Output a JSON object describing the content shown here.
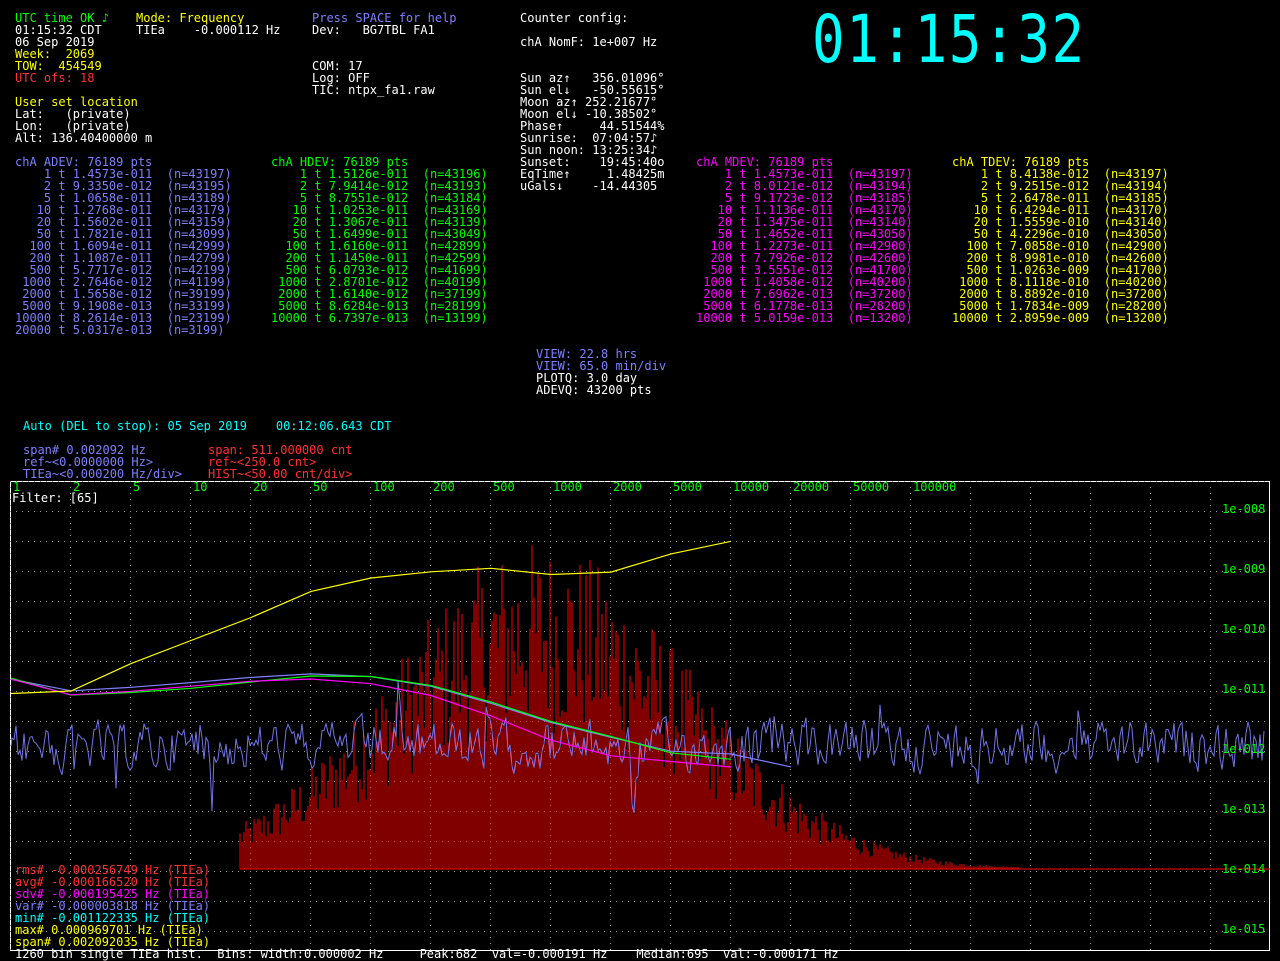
{
  "status": {
    "utc_status": "UTC time OK ♪",
    "time_line": "01:15:32 CDT",
    "date": "06 Sep 2019",
    "week": "Week:  2069",
    "tow": "TOW:  454549",
    "utc_ofs": "UTC ofs: 18",
    "mode": "Mode: Frequency",
    "tiea": "TIEa    -0.000112 Hz",
    "help": "Press SPACE for help",
    "dev": "Dev:   BG7TBL FA1",
    "com": "COM: 17",
    "log": "Log: OFF",
    "tic": "TIC: ntpx_fa1.raw",
    "counter_title": "Counter config:",
    "nomf": "chA NomF: 1e+007 Hz"
  },
  "location": {
    "title": "User set location",
    "lat": "Lat:   (private)",
    "lon": "Lon:   (private)",
    "alt": "Alt: 136.40400000 m"
  },
  "astro": [
    "Sun az↑   356.01096°",
    "Sun el↓   -50.55615°",
    "Moon az↑ 252.21677°",
    "Moon el↓ -10.38502°",
    "Phase↑     44.51544%",
    "Sunrise:  07:04:57♪",
    "Sun noon: 13:25:34♪",
    "Sunset:    19:45:40o",
    "EqTime↑     1.48425m",
    "uGals↓    -14.44305"
  ],
  "clock": "01:15:32",
  "adev": {
    "title": "chA ADEV: 76189 pts",
    "rows": [
      "    1 t 1.4573e-011  (n=43197)",
      "    2 t 9.3350e-012  (n=43195)",
      "    5 t 1.0658e-011  (n=43189)",
      "   10 t 1.2768e-011  (n=43179)",
      "   20 t 1.5602e-011  (n=43159)",
      "   50 t 1.7821e-011  (n=43099)",
      "  100 t 1.6094e-011  (n=42999)",
      "  200 t 1.1087e-011  (n=42799)",
      "  500 t 5.7717e-012  (n=42199)",
      " 1000 t 2.7646e-012  (n=41199)",
      " 2000 t 1.5658e-012  (n=39199)",
      " 5000 t 9.1908e-013  (n=33199)",
      "10000 t 8.2614e-013  (n=23199)",
      "20000 t 5.0317e-013  (n=3199)"
    ]
  },
  "hdev": {
    "title": "chA HDEV: 76189 pts",
    "rows": [
      "    1 t 1.5126e-011  (n=43196)",
      "    2 t 7.9414e-012  (n=43193)",
      "    5 t 8.7551e-012  (n=43184)",
      "   10 t 1.0253e-011  (n=43169)",
      "   20 t 1.3067e-011  (n=43139)",
      "   50 t 1.6499e-011  (n=43049)",
      "  100 t 1.6160e-011  (n=42899)",
      "  200 t 1.1450e-011  (n=42599)",
      "  500 t 6.0793e-012  (n=41699)",
      " 1000 t 2.8701e-012  (n=40199)",
      " 2000 t 1.6140e-012  (n=37199)",
      " 5000 t 8.6284e-013  (n=28199)",
      "10000 t 6.7397e-013  (n=13199)"
    ]
  },
  "mdev": {
    "title": "chA MDEV: 76189 pts",
    "rows": [
      "    1 t 1.4573e-011  (n=43197)",
      "    2 t 8.0121e-012  (n=43194)",
      "    5 t 9.1723e-012  (n=43185)",
      "   10 t 1.1136e-011  (n=43170)",
      "   20 t 1.3475e-011  (n=43140)",
      "   50 t 1.4652e-011  (n=43050)",
      "  100 t 1.2273e-011  (n=42900)",
      "  200 t 7.7926e-012  (n=42600)",
      "  500 t 3.5551e-012  (n=41700)",
      " 1000 t 1.4058e-012  (n=40200)",
      " 2000 t 7.6962e-013  (n=37200)",
      " 5000 t 6.1778e-013  (n=28200)",
      "10000 t 5.0159e-013  (n=13200)"
    ]
  },
  "tdev": {
    "title": "chA TDEV: 76189 pts",
    "rows": [
      "    1 t 8.4138e-012  (n=43197)",
      "    2 t 9.2515e-012  (n=43194)",
      "    5 t 2.6478e-011  (n=43185)",
      "   10 t 6.4294e-011  (n=43170)",
      "   20 t 1.5559e-010  (n=43140)",
      "   50 t 4.2296e-010  (n=43050)",
      "  100 t 7.0858e-010  (n=42900)",
      "  200 t 8.9981e-010  (n=42600)",
      "  500 t 1.0263e-009  (n=41700)",
      " 1000 t 8.1118e-010  (n=40200)",
      " 2000 t 8.8892e-010  (n=37200)",
      " 5000 t 1.7834e-009  (n=28200)",
      "10000 t 2.8959e-009  (n=13200)"
    ]
  },
  "view": {
    "view_hrs": "VIEW: 22.8 hrs",
    "view_min": "VIEW: 65.0 min/div",
    "plotq": "PLOTQ: 3.0 day",
    "adevq": "ADEVQ: 43200 pts"
  },
  "auto_line": "Auto (DEL to stop): 05 Sep 2019    00:12:06.643 CDT",
  "scale": {
    "span_hz": "span# 0.002092 Hz",
    "ref_hz": "ref~<0.0000000 Hz>",
    "tiea_div": "TIEa~<0.000200 Hz/div>",
    "span_cnt": "span: 511.000000 cnt",
    "ref_cnt": "ref~<250.0 cnt>",
    "hist_div": "HIST~<50.00 cnt/div>"
  },
  "filter": "Filter: [65]",
  "tau_labels": [
    "1",
    "2",
    "5",
    "10",
    "20",
    "50",
    "100",
    "200",
    "500",
    "1000",
    "2000",
    "5000",
    "10000",
    "20000",
    "50000",
    "100000"
  ],
  "decade_labels": [
    "1e-008",
    "1e-009",
    "1e-010",
    "1e-011",
    "1e-012",
    "1e-013",
    "1e-014",
    "1e-015"
  ],
  "stats": {
    "rms": "rms# -0.000256749 Hz (TIEa)",
    "avg": "avg# -0.000166520 Hz (TIEa)",
    "sdv": "sdv# -0.000195425 Hz (TIEa)",
    "var": "var# -0.000003818 Hz (TIEa)",
    "min": "min# -0.001122335 Hz (TIEa)",
    "max": "max# 0.000969701 Hz (TIEa)",
    "span": "span# 0.002092035 Hz (TIEa)"
  },
  "bottom_line": "1260 bin single TIEa hist.  Bins: width:0.000002 Hz     Peak:682  val=-0.000191 Hz    Median:695  val:-0.000171 Hz",
  "colors": {
    "adev": "#7f7fff",
    "hdev": "#00ff00",
    "mdev": "#ff00ff",
    "tdev": "#ffff00",
    "hist": "#ff0000",
    "tiea": "#7f7fff",
    "grid": "#ffffff"
  },
  "chart_data": {
    "type": "line",
    "xscale": "log",
    "yscale": "log",
    "x_tau": [
      1,
      2,
      5,
      10,
      20,
      50,
      100,
      200,
      500,
      1000,
      2000,
      5000,
      10000,
      20000
    ],
    "series": [
      {
        "name": "chA ADEV",
        "values": [
          1.4573e-11,
          9.335e-12,
          1.0658e-11,
          1.2768e-11,
          1.5602e-11,
          1.7821e-11,
          1.6094e-11,
          1.1087e-11,
          5.7717e-12,
          2.7646e-12,
          1.5658e-12,
          9.1908e-13,
          8.2614e-13,
          5.0317e-13
        ]
      },
      {
        "name": "chA HDEV",
        "values": [
          1.5126e-11,
          7.9414e-12,
          8.7551e-12,
          1.0253e-11,
          1.3067e-11,
          1.6499e-11,
          1.616e-11,
          1.145e-11,
          6.0793e-12,
          2.8701e-12,
          1.614e-12,
          8.6284e-13,
          6.7397e-13
        ]
      },
      {
        "name": "chA MDEV",
        "values": [
          1.4573e-11,
          8.0121e-12,
          9.1723e-12,
          1.1136e-11,
          1.3475e-11,
          1.4652e-11,
          1.2273e-11,
          7.7926e-12,
          3.5551e-12,
          1.4058e-12,
          7.6962e-13,
          6.1778e-13,
          5.0159e-13
        ]
      },
      {
        "name": "chA TDEV",
        "values": [
          8.4138e-12,
          9.2515e-12,
          2.6478e-11,
          6.4294e-11,
          1.5559e-10,
          4.2296e-10,
          7.0858e-10,
          8.9981e-10,
          1.0263e-09,
          8.1118e-10,
          8.8892e-10,
          1.7834e-09,
          2.8959e-09
        ]
      }
    ],
    "ylim": [
      1e-15,
      1e-08
    ],
    "xlim": [
      1,
      100000
    ],
    "grid": true
  }
}
